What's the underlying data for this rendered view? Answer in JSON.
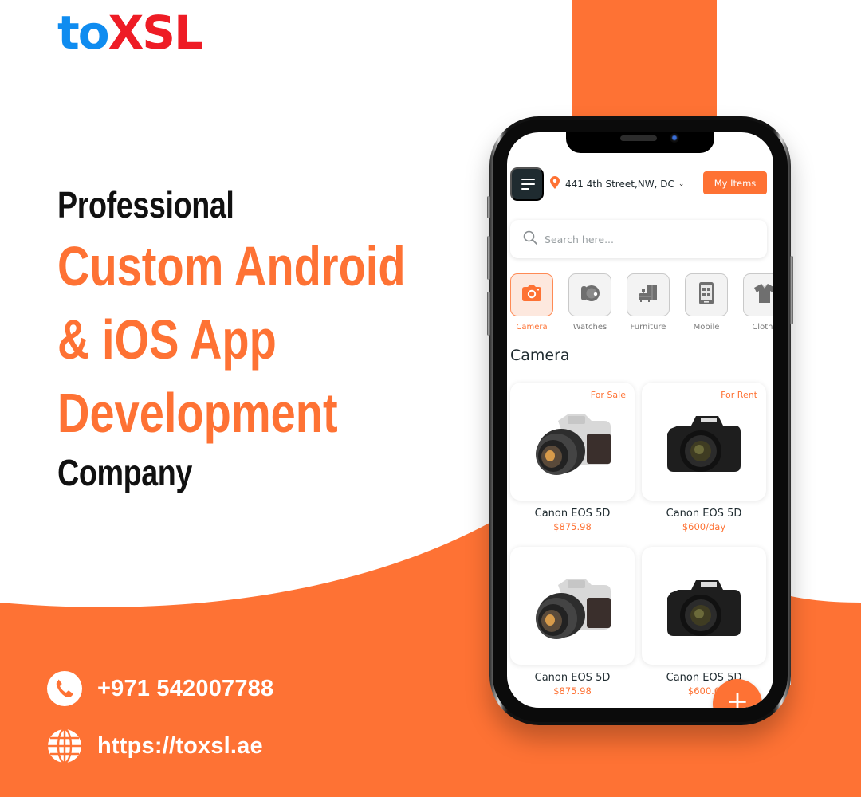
{
  "brand": {
    "logo_part1": "to",
    "logo_part2": "XSL",
    "primary_color": "#fe7234",
    "logo_blue": "#0f8cf0",
    "logo_red": "#ee1c25"
  },
  "headline": {
    "line1": "Professional",
    "line2": "Custom Android",
    "line3": "& iOS App",
    "line4": "Development",
    "line5": "Company"
  },
  "contacts": {
    "phone_icon": "phone-icon",
    "phone": "+971 542007788",
    "web_icon": "globe-icon",
    "website": "https://toxsl.ae"
  },
  "app": {
    "menu_icon": "menu-icon",
    "location_icon": "map-pin-icon",
    "location": "441 4th Street,NW, DC",
    "location_chevron": "⌄",
    "my_items_label": "My Items",
    "search_placeholder": "Search here...",
    "categories": [
      {
        "label": "Camera",
        "icon": "camera-icon",
        "active": true
      },
      {
        "label": "Watches",
        "icon": "watch-icon",
        "active": false
      },
      {
        "label": "Furniture",
        "icon": "furniture-icon",
        "active": false
      },
      {
        "label": "Mobile",
        "icon": "mobile-icon",
        "active": false
      },
      {
        "label": "Cloths",
        "icon": "shirt-icon",
        "active": false
      }
    ],
    "section_title": "Camera",
    "products": [
      {
        "tag": "For Sale",
        "name": "Canon EOS 5D",
        "price": "$875.98",
        "image": "silver-camera"
      },
      {
        "tag": "For Rent",
        "name": "Canon EOS 5D",
        "price": "$600/day",
        "image": "black-dslr-camera"
      },
      {
        "tag": "",
        "name": "Canon EOS 5D",
        "price": "$875.98",
        "image": "silver-camera"
      },
      {
        "tag": "",
        "name": "Canon EOS 5D",
        "price": "$600.6",
        "image": "black-dslr-camera"
      }
    ],
    "fab_label": "+"
  }
}
